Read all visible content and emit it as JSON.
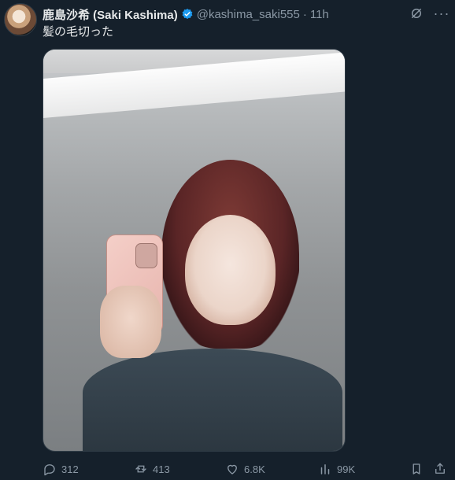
{
  "tweet": {
    "display_name": "鹿島沙希 (Saki Kashima)",
    "handle": "@kashima_saki555",
    "separator": "·",
    "time": "11h",
    "text": "髪の毛切った"
  },
  "top_actions": {
    "grok_icon": "grok-icon",
    "more_icon": "more-icon",
    "more_label": "···"
  },
  "actions": {
    "replies": "312",
    "retweets": "413",
    "likes": "6.8K",
    "views": "99K"
  },
  "colors": {
    "background": "#15202b",
    "muted": "#8b98a5",
    "verified": "#1d9bf0"
  }
}
